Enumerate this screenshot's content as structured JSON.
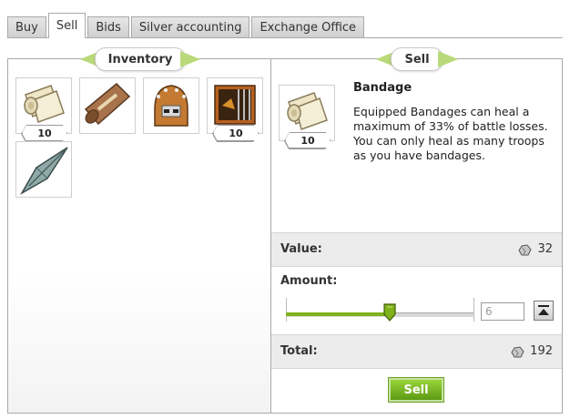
{
  "tabs": [
    {
      "label": "Buy",
      "active": false
    },
    {
      "label": "Sell",
      "active": true
    },
    {
      "label": "Bids",
      "active": false
    },
    {
      "label": "Silver accounting",
      "active": false
    },
    {
      "label": "Exchange Office",
      "active": false
    }
  ],
  "inventory": {
    "title": "Inventory",
    "items": [
      {
        "icon": "bandage-scroll-icon",
        "count": "10"
      },
      {
        "icon": "rolled-parchment-icon",
        "count": ""
      },
      {
        "icon": "spiked-helmet-icon",
        "count": ""
      },
      {
        "icon": "wooden-cage-icon",
        "count": "10"
      },
      {
        "icon": "spear-head-icon",
        "count": ""
      }
    ]
  },
  "sell": {
    "title": "Sell",
    "item": {
      "icon": "bandage-scroll-icon",
      "count": "10",
      "name": "Bandage",
      "description": "Equipped Bandages can heal a maximum of 33% of battle losses. You can only heal as many troops as you have bandages."
    },
    "value_label": "Value:",
    "value": "32",
    "amount_label": "Amount:",
    "amount": "6",
    "amount_max": "10",
    "total_label": "Total:",
    "total": "192",
    "button_label": "Sell"
  },
  "colors": {
    "accent_green": "#7fb11a",
    "ribbon_green": "#b9d97a",
    "row_gray": "#ececec"
  }
}
